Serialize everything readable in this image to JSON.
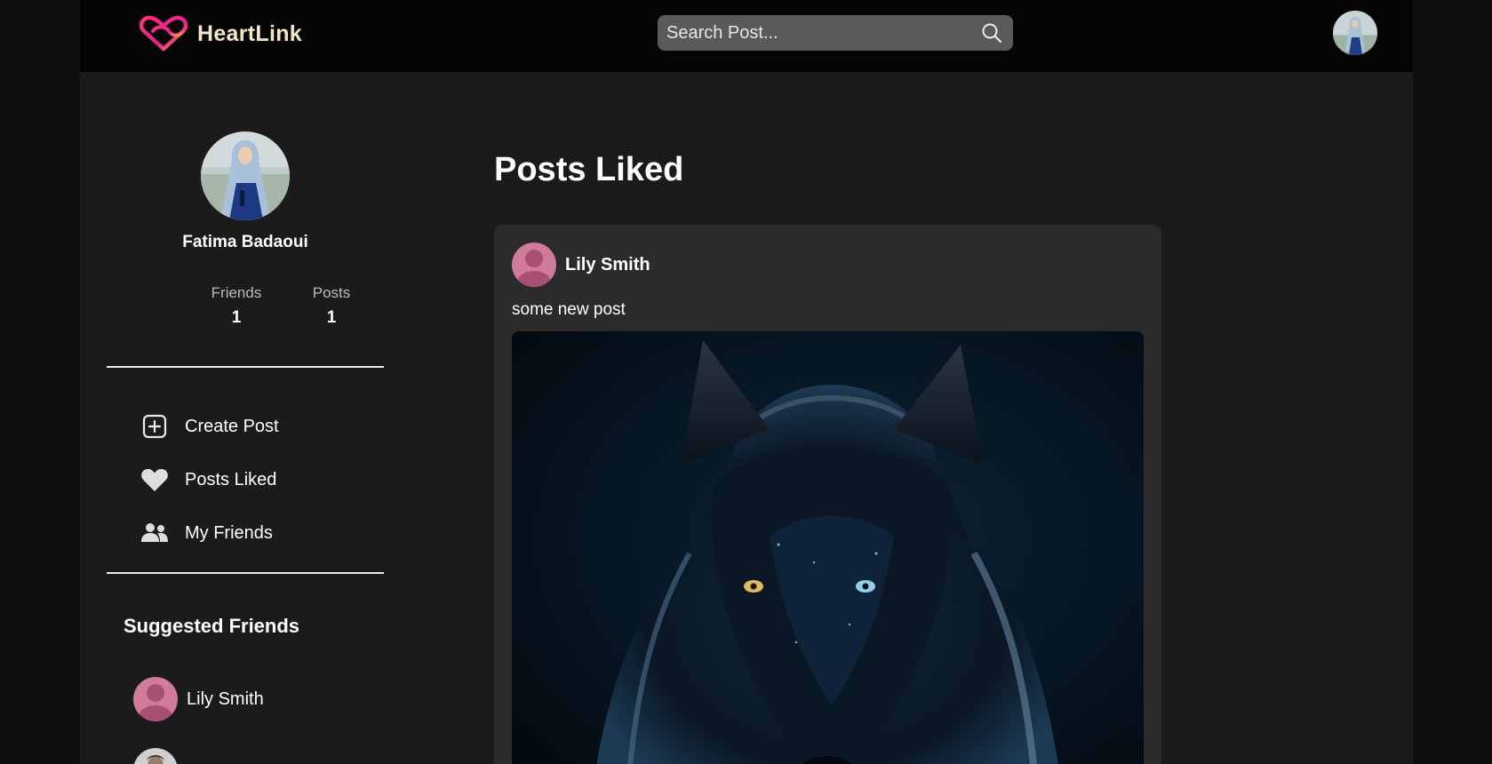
{
  "app": {
    "name": "HeartLink"
  },
  "search": {
    "placeholder": "Search Post..."
  },
  "profile": {
    "name": "Fatima Badaoui",
    "stats": [
      {
        "label": "Friends",
        "value": "1"
      },
      {
        "label": "Posts",
        "value": "1"
      }
    ]
  },
  "nav": {
    "items": [
      {
        "label": "Create Post",
        "icon": "plus-square-icon"
      },
      {
        "label": "Posts Liked",
        "icon": "heart-icon"
      },
      {
        "label": "My Friends",
        "icon": "users-icon"
      }
    ]
  },
  "suggested": {
    "title": "Suggested Friends",
    "friends": [
      {
        "name": "Lily Smith",
        "avatar": "default-avatar-pink"
      }
    ]
  },
  "main": {
    "title": "Posts Liked",
    "posts": [
      {
        "author": "Lily Smith",
        "text": "some new post",
        "image": "wolf-photo"
      }
    ]
  },
  "colors": {
    "background": "#1b1b1b",
    "header": "#050505",
    "card": "#2b2b2b",
    "search": "#5a5a5a",
    "accent_pink": "#d07a9c"
  }
}
